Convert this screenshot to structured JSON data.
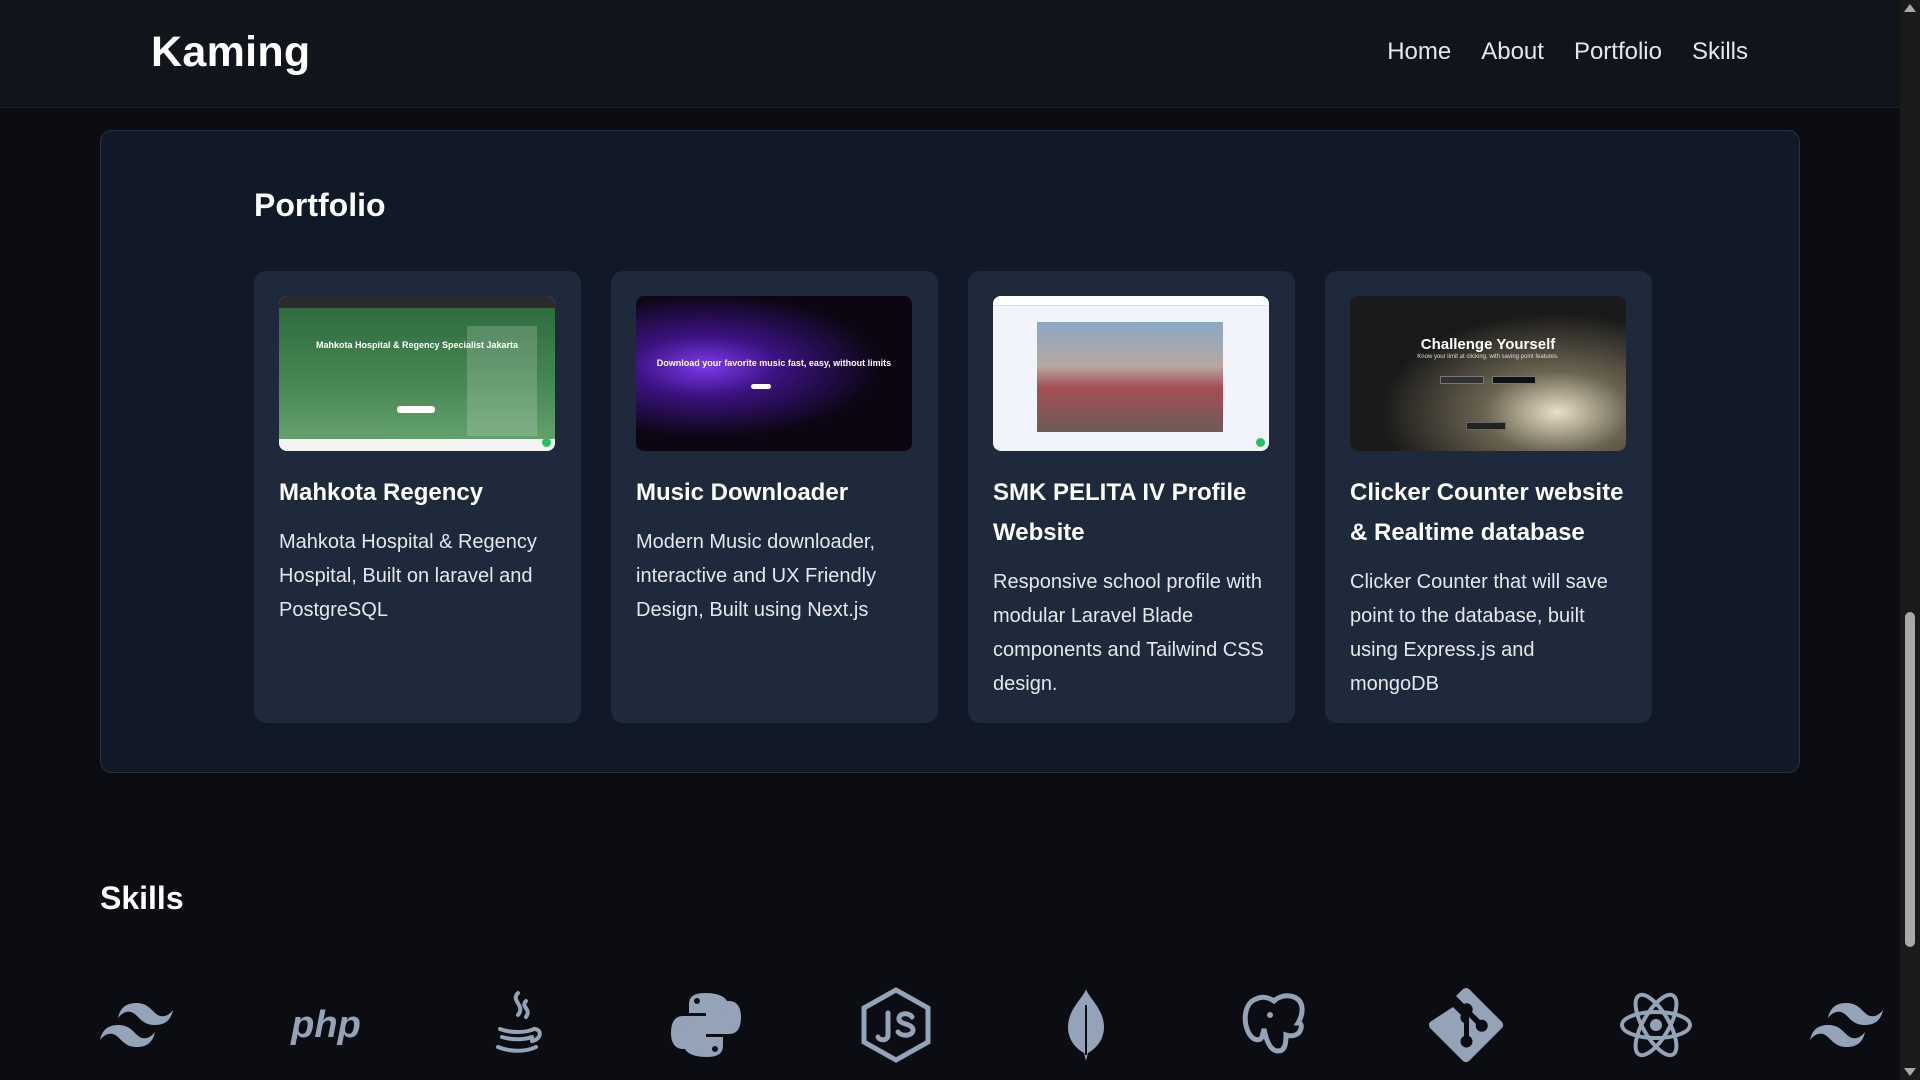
{
  "header": {
    "brand": "Kaming",
    "nav": [
      "Home",
      "About",
      "Portfolio",
      "Skills"
    ]
  },
  "portfolio": {
    "title": "Portfolio",
    "cards": [
      {
        "title": "Mahkota Regency",
        "description": "Mahkota Hospital & Regency Hospital, Built on laravel and PostgreSQL",
        "thumb_heading": "Mahkota Hospital & Regency Specialist Jakarta"
      },
      {
        "title": "Music Downloader",
        "description": "Modern Music downloader, interactive and UX Friendly Design, Built using Next.js",
        "thumb_heading": "Download your favorite music fast, easy, without limits"
      },
      {
        "title": "SMK PELITA IV Profile Website",
        "description": "Responsive school profile with modular Laravel Blade components and Tailwind CSS design."
      },
      {
        "title": "Clicker Counter website & Realtime database",
        "description": "Clicker Counter that will save point to the database, built using Express.js and mongoDB",
        "thumb_heading": "Challenge Yourself",
        "thumb_sub": "Know your limit at clicking, with saving point features."
      }
    ]
  },
  "skills": {
    "title": "Skills",
    "icons": [
      "tailwind-icon",
      "php-icon",
      "java-icon",
      "python-icon",
      "nodejs-icon",
      "mongodb-icon",
      "postgresql-icon",
      "git-icon",
      "react-icon",
      "tailwind-icon"
    ],
    "php_text": "php",
    "icon_color": "#94a3b8"
  },
  "colors": {
    "background": "#0b0d12",
    "panel": "#111827",
    "card": "#1e293b",
    "text": "#e5e7eb"
  }
}
